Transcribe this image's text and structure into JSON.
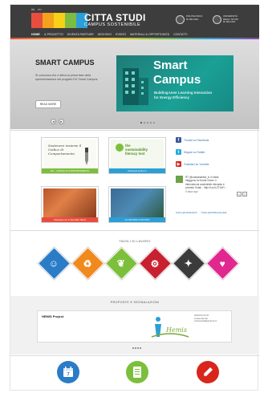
{
  "header": {
    "lang_it": "ita",
    "lang_en": "en",
    "logo_title": "CITTA STUDI",
    "logo_sub": "CAMPUS SOSTENIBILE",
    "polimi": "POLITECNICO\nDI MILANO",
    "unimi": "UNIVERSITÀ\nDEGLI STUDI\nDI MILANO",
    "logo_colors": [
      "#e94d3f",
      "#f4a11d",
      "#f6d117",
      "#7dbb42",
      "#2b9fd6"
    ]
  },
  "nav": {
    "items": [
      "HOME",
      "IL PROGETTO",
      "DIVENTA PARTNER",
      "ARCHIVIO",
      "EVENTI",
      "MATERIALI & OPPORTUNITÀ",
      "CONTATTI"
    ]
  },
  "hero": {
    "title": "SMART CAMPUS",
    "text": "Si comunica che è attiva la prima fase della sperimentazione del progetto EU Smart Campus.",
    "button": "READ MORE",
    "promo_title_1": "Smart",
    "promo_title_2": "Campus",
    "promo_sub_1": "Building-User Learning Interaction",
    "promo_sub_2": "for Energy Efficiency",
    "prev": "◄",
    "next": "►",
    "dot_count": 5
  },
  "tiles": {
    "t1_hand": "Sostenere insieme il Codice di Comportamento",
    "t1_cap": "VAI... CODICE DI COMPORTAMENTO",
    "t2_title_1": "the",
    "t2_title_2": "sustainability",
    "t2_title_3": "literacy test",
    "t2_cap": "Partecipa anche tu",
    "t3_cap": "Partecipa con lo Sportello Talent",
    "t4_cap": "LO GROSSO CON UNO"
  },
  "social": {
    "facebook": "Trovaci su Facebook",
    "twitter": "Seguici su Twitter",
    "youtube": "Guardaci su Youtube",
    "tweet": "RT @sustainabled_it: in Italia riteggono la Social Green 4 intervista da sostenibile rilevante e previsto l'Istat... http://t.co/LZT1dIY...",
    "tweet_time": "4 days ago",
    "link1": "Follow @CittaStudiCS",
    "link2": "Follow @PoliMi/sostenibile",
    "colors": {
      "facebook": "#3b5998",
      "twitter": "#29a9e1",
      "youtube": "#d9261c"
    }
  },
  "tables": {
    "title": "TAVOLI DI LAVORO",
    "colors": [
      "#2b7cc7",
      "#f08a1e",
      "#7cbf3b",
      "#c8202e",
      "#3b3b3b",
      "#e0288f"
    ],
    "icons": [
      "people-icon",
      "recycle-icon",
      "leaf-icon",
      "bike-icon",
      "gear-icon",
      "heart-icon"
    ]
  },
  "proposals": {
    "title": "PROPOSTE E SEGNALAZIONI",
    "item_name": "HEMIS Project",
    "logo_word": "Hemis",
    "meta_1": "02/04/13 22:22",
    "meta_2": "inviata dal sito sciansstudi@gmail.com"
  },
  "footer_icons": [
    {
      "name": "calendar-icon",
      "color": "#2b7cc7",
      "label": "7"
    },
    {
      "name": "document-icon",
      "color": "#7cbf3b"
    },
    {
      "name": "pencil-icon",
      "color": "#d9261c"
    }
  ]
}
